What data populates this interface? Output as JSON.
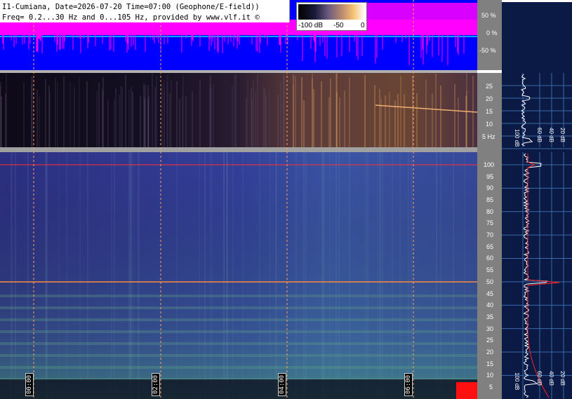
{
  "header": {
    "line1": "I1-Cumiana, Date=2026-07-20 Time=07:00 (Geophone/E-field))",
    "line2": "Freq= 0.2...30 Hz and 0...105 Hz, provided by www.vlf.it ©"
  },
  "colorbar": {
    "labels": [
      "-100 dB",
      "-50",
      "0"
    ]
  },
  "amplitude_panel": {
    "ticks": [
      "50 %",
      "0 %",
      "-50 %"
    ]
  },
  "low_freq_panel": {
    "ticks": [
      "25",
      "20",
      "15",
      "10",
      "5 Hz"
    ],
    "spectrum_labels": [
      "100 dB",
      "60 dB",
      "40 dB",
      "20 dB"
    ]
  },
  "high_freq_panel": {
    "ticks": [
      "100",
      "95",
      "90",
      "85",
      "80",
      "75",
      "70",
      "65",
      "60",
      "55",
      "50",
      "45",
      "40",
      "35",
      "30",
      "25",
      "20",
      "15",
      "10",
      "5"
    ],
    "spectrum_labels": [
      "100 dB",
      "60 dB",
      "40 dB",
      "20 dB"
    ]
  },
  "time_markers": [
    "00:00",
    "02:00",
    "04:00",
    "06:00"
  ],
  "colors": {
    "amp_bg": "#0000ff",
    "amp_signal": "#ff00ff",
    "panel_bg": "#808080",
    "right_bg": "#0b1a45",
    "grid_red": "#ff2020"
  }
}
